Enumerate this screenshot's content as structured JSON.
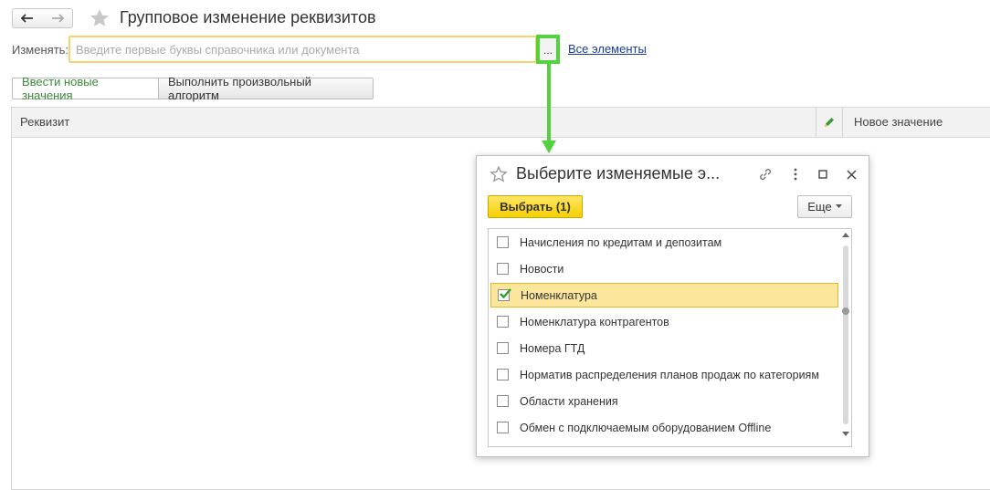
{
  "header": {
    "title": "Групповое изменение реквизитов"
  },
  "form": {
    "change_label": "Изменять:",
    "change_placeholder": "Введите первые буквы справочника или документа",
    "select_button": "...",
    "all_elements_link": "Все элементы"
  },
  "tabs": [
    {
      "label": "Ввести новые значения"
    },
    {
      "label": "Выполнить произвольный алгоритм"
    }
  ],
  "table": {
    "col_attribute": "Реквизит",
    "col_new_value": "Новое значение"
  },
  "dialog": {
    "title": "Выберите изменяемые э...",
    "choose_button": "Выбрать (1)",
    "more_button": "Еще",
    "items": [
      {
        "label": "Начисления по кредитам и депозитам",
        "checked": false
      },
      {
        "label": "Новости",
        "checked": false
      },
      {
        "label": "Номенклатура",
        "checked": true
      },
      {
        "label": "Номенклатура контрагентов",
        "checked": false
      },
      {
        "label": "Номера ГТД",
        "checked": false
      },
      {
        "label": "Норматив распределения планов продаж по категориям",
        "checked": false
      },
      {
        "label": "Области хранения",
        "checked": false
      },
      {
        "label": "Обмен с подключаемым оборудованием Offline",
        "checked": false
      }
    ]
  },
  "colors": {
    "highlight_green": "#54d13f",
    "selection_yellow": "#fbe69c",
    "button_yellow": "#f5d000",
    "link_blue": "#1a3c9c",
    "check_green": "#2e9e2e"
  }
}
